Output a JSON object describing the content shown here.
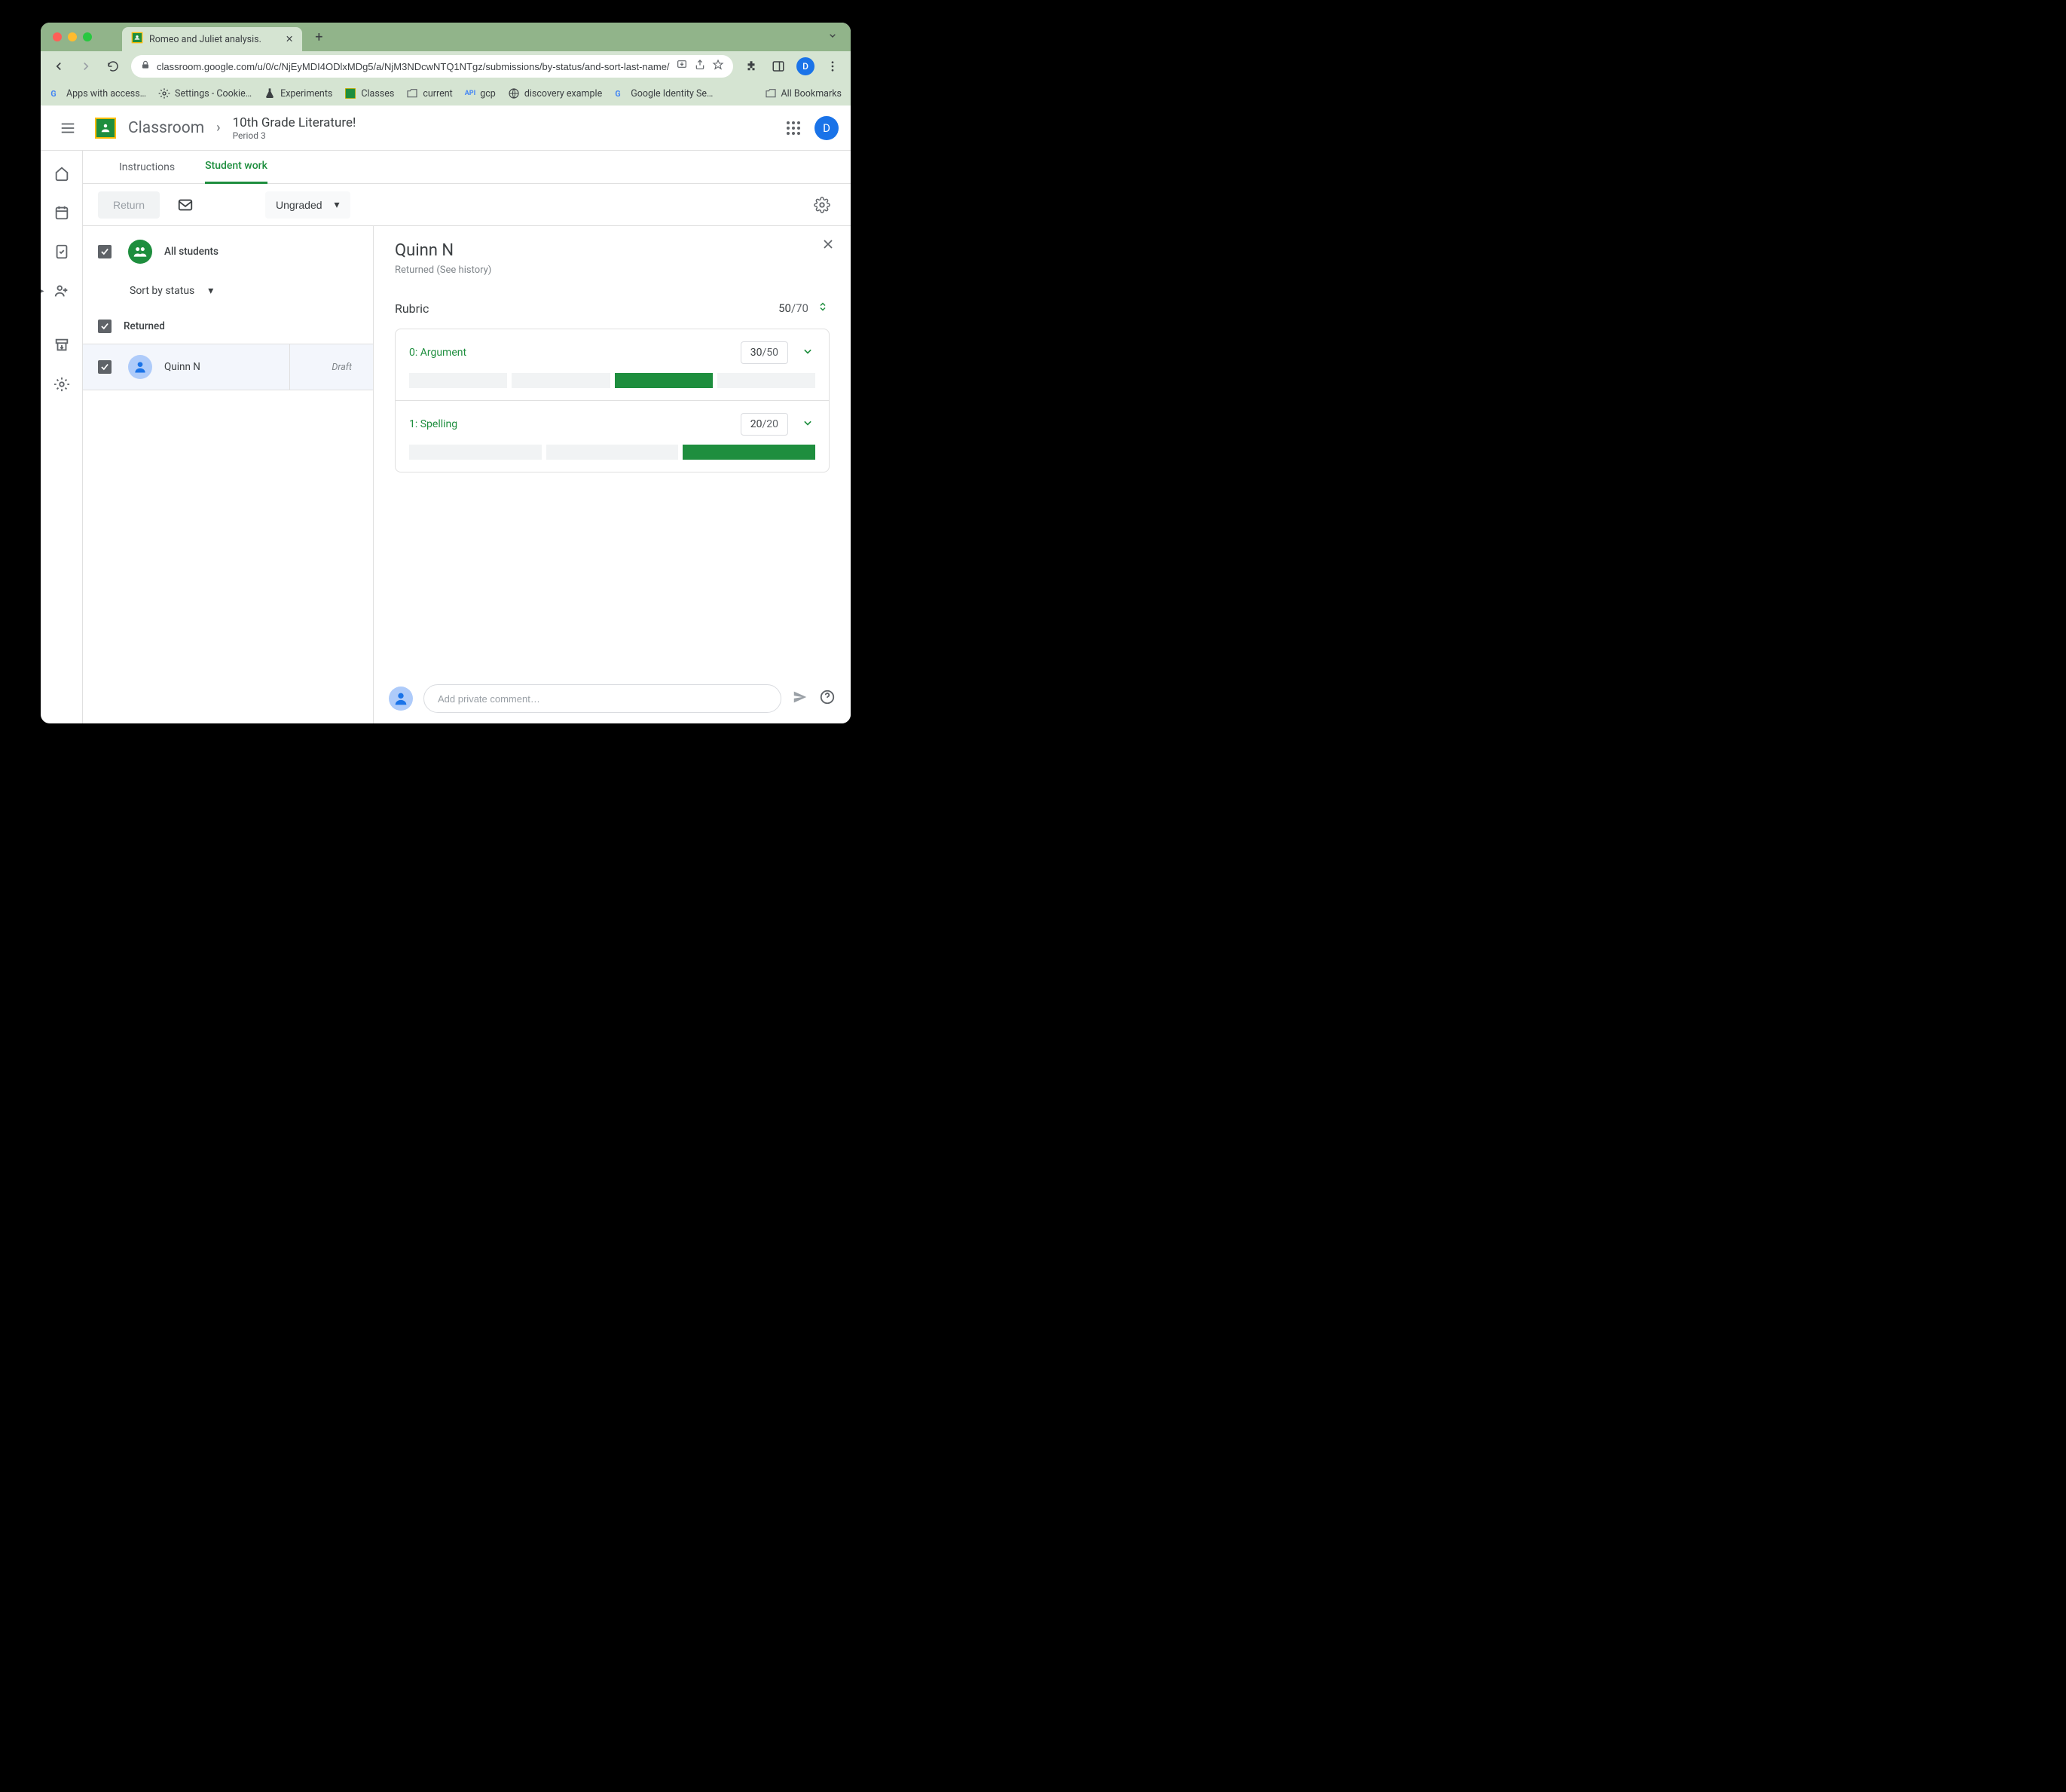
{
  "browser": {
    "tab_title": "Romeo and Juliet analysis.",
    "url": "classroom.google.com/u/0/c/NjEyMDI4ODlxMDg5/a/NjM3NDcwNTQ1NTgz/submissions/by-status/and-sort-last-name/student/NTI1…",
    "bookmarks": [
      "Apps with access…",
      "Settings - Cookie…",
      "Experiments",
      "Classes",
      "current",
      "gcp",
      "discovery example",
      "Google Identity Se…"
    ],
    "all_bookmarks": "All Bookmarks",
    "avatar_letter": "D"
  },
  "header": {
    "app_name": "Classroom",
    "class_name": "10th Grade Literature!",
    "period": "Period 3",
    "avatar_letter": "D"
  },
  "tabs": {
    "instructions": "Instructions",
    "student_work": "Student work"
  },
  "action_bar": {
    "return": "Return",
    "filter": "Ungraded"
  },
  "student_list": {
    "all_students": "All students",
    "sort_label": "Sort by status",
    "group_label": "Returned",
    "students": [
      {
        "name": "Quinn N",
        "status": "Draft"
      }
    ]
  },
  "detail": {
    "student_name": "Quinn N",
    "status": "Returned (See history)",
    "rubric_label": "Rubric",
    "score_num": "50",
    "score_denom": "/70",
    "criteria": [
      {
        "name": "0: Argument",
        "score": "30",
        "denom": "/50",
        "levels": [
          false,
          false,
          true,
          false
        ]
      },
      {
        "name": "1: Spelling",
        "score": "20",
        "denom": "/20",
        "levels": [
          false,
          false,
          true
        ]
      }
    ]
  },
  "comment": {
    "placeholder": "Add private comment…"
  }
}
